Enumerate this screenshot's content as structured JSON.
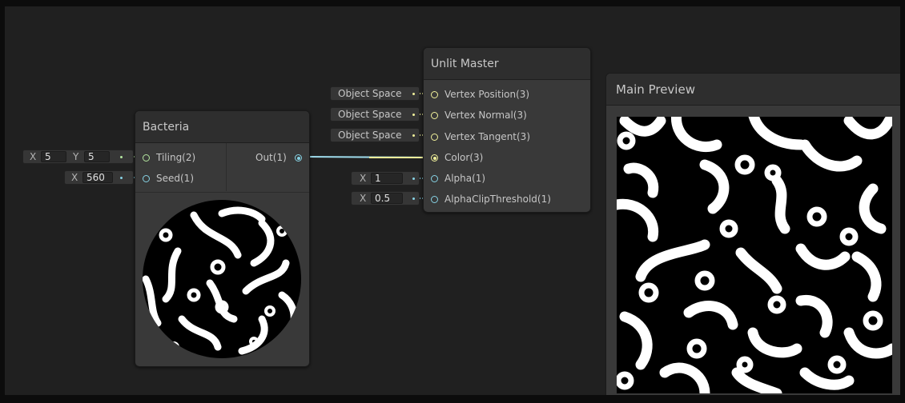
{
  "bacteria_node": {
    "title": "Bacteria",
    "inputs": [
      {
        "label": "Tiling(2)",
        "port": "green"
      },
      {
        "label": "Seed(1)",
        "port": "cyan"
      }
    ],
    "output": {
      "label": "Out(1)",
      "port": "cyan"
    }
  },
  "tiling_field": {
    "x_label": "X",
    "x_value": "5",
    "y_label": "Y",
    "y_value": "5"
  },
  "seed_field": {
    "x_label": "X",
    "x_value": "560"
  },
  "master_node": {
    "title": "Unlit Master",
    "inputs": [
      {
        "label": "Vertex Position(3)",
        "port": "yellow"
      },
      {
        "label": "Vertex Normal(3)",
        "port": "yellow"
      },
      {
        "label": "Vertex Tangent(3)",
        "port": "yellow"
      },
      {
        "label": "Color(3)",
        "port": "yellow"
      },
      {
        "label": "Alpha(1)",
        "port": "cyan"
      },
      {
        "label": "AlphaClipThreshold(1)",
        "port": "cyan"
      }
    ]
  },
  "space_fields": [
    "Object Space",
    "Object Space",
    "Object Space"
  ],
  "alpha_field": {
    "x_label": "X",
    "x_value": "1"
  },
  "clip_field": {
    "x_label": "X",
    "x_value": "0.5"
  },
  "main_preview": {
    "title": "Main Preview"
  },
  "colors": {
    "canvas": "#202020",
    "node_body": "#393939",
    "node_header": "#2e2e2e",
    "vector3_port": "#f0f09a",
    "vector1_port": "#86d2e4",
    "vector2_port": "#b4e6a0"
  }
}
